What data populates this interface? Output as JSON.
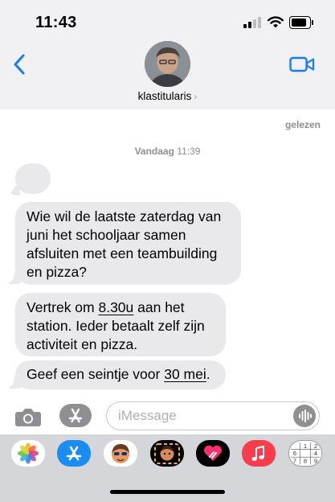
{
  "status_bar": {
    "time": "11:43",
    "signal_icon": "cellular-signal-icon",
    "wifi_icon": "wifi-icon",
    "battery_icon": "battery-icon"
  },
  "header": {
    "back_icon": "chevron-left-icon",
    "video_icon": "video-camera-icon",
    "contact_name": "klastitularis",
    "contact_chevron": "›",
    "accent_color": "#1a7cf5"
  },
  "conversation": {
    "read_receipt": "gelezen",
    "timestamp_day": "Vandaag",
    "timestamp_time": "11:39",
    "messages": [
      {
        "text": "Wie wil de laatste zaterdag van juni het schooljaar samen afsluiten met een teambuilding en pizza?"
      },
      {
        "text_before": "Vertrek om ",
        "text_link": "8.30u",
        "text_after": " aan het station. Ieder betaalt zelf zijn activiteit en pizza."
      },
      {
        "text_before": "Geef een seintje voor ",
        "text_link": "30 mei",
        "text_after": "."
      }
    ],
    "bubble_color": "#e9e9eb"
  },
  "composer": {
    "camera_icon": "camera-icon",
    "apps_icon": "app-store-icon",
    "placeholder": "iMessage",
    "voice_icon": "waveform-icon"
  },
  "app_drawer": {
    "apps": [
      {
        "name": "photos-app-icon"
      },
      {
        "name": "app-store-app-icon"
      },
      {
        "name": "memoji-app-icon"
      },
      {
        "name": "memoji-stickers-app-icon"
      },
      {
        "name": "digital-touch-app-icon"
      },
      {
        "name": "music-app-icon"
      },
      {
        "name": "sudoku-app-icon"
      }
    ],
    "sudoku_digits": [
      "1",
      "2",
      "3",
      "6",
      "4",
      "7",
      "8",
      "9"
    ]
  }
}
